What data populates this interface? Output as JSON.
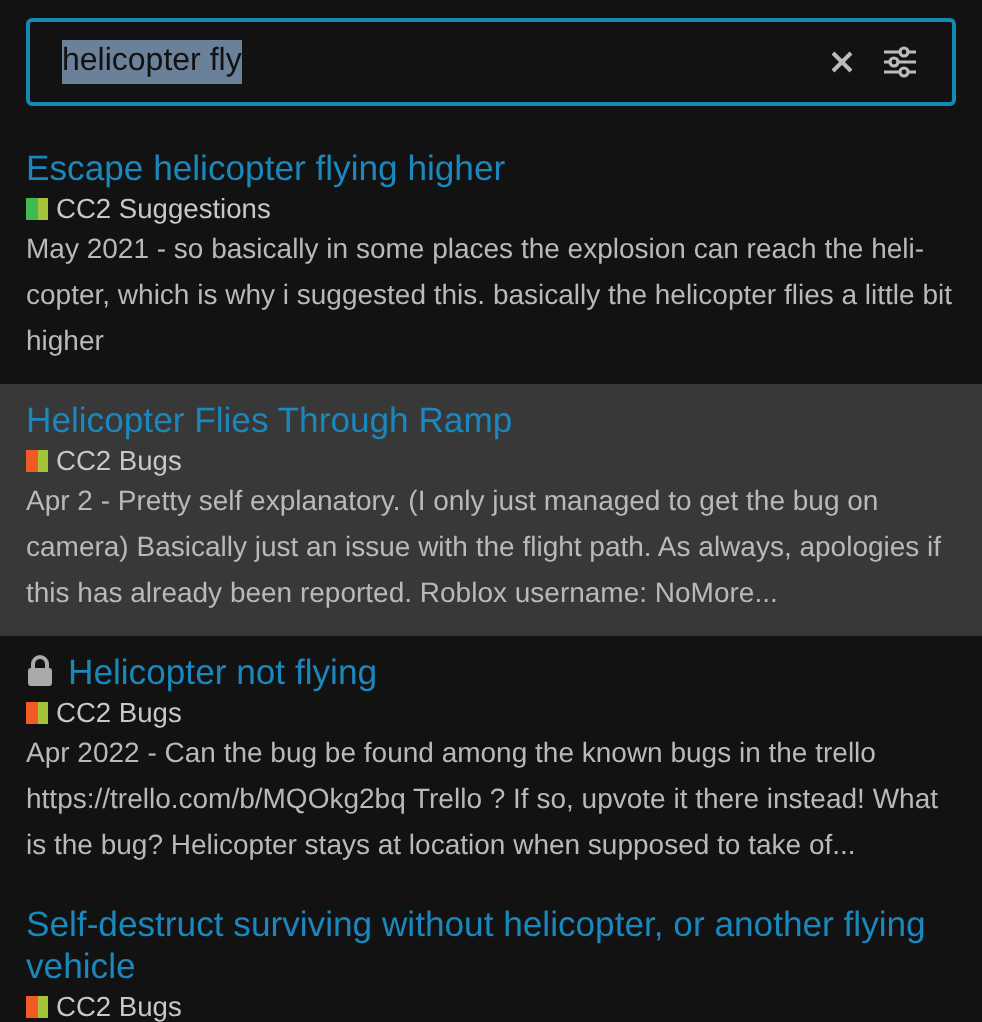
{
  "search": {
    "value": "helicopter fly",
    "value_selected": true
  },
  "results": [
    {
      "title": "Escape helicopter flying higher",
      "locked": false,
      "selected": false,
      "category": {
        "name": "CC2 Suggestions",
        "colors": [
          {
            "color": "#3fb950"
          },
          {
            "color": "#a4c339"
          }
        ]
      },
      "excerpt": "May 2021 - so basically in some places the explosion can reach the heli-copter, which is why i suggested this. basically the helicopter flies a little bit higher"
    },
    {
      "title": "Helicopter Flies Through Ramp",
      "locked": false,
      "selected": true,
      "category": {
        "name": "CC2 Bugs",
        "colors": [
          {
            "color": "#f15a24"
          },
          {
            "color": "#a4c339"
          }
        ]
      },
      "excerpt": "Apr 2 - Pretty self explanatory. (I only just managed to get the bug on camera) Basically just an issue with the flight path. As always, apologies if this has already been reported. Roblox username: NoMore..."
    },
    {
      "title": "Helicopter not flying",
      "locked": true,
      "selected": false,
      "category": {
        "name": "CC2 Bugs",
        "colors": [
          {
            "color": "#f15a24"
          },
          {
            "color": "#a4c339"
          }
        ]
      },
      "excerpt": "Apr 2022 - Can the bug be found among the known bugs in the trello https://trello.com/b/MQOkg2bq Trello ? If so, upvote it there instead! What is the bug? Helicopter stays at location when supposed to take of..."
    },
    {
      "title": "Self-destruct surviving without helicopter, or another flying vehicle",
      "locked": false,
      "selected": false,
      "category": {
        "name": "CC2 Bugs",
        "colors": [
          {
            "color": "#f15a24"
          },
          {
            "color": "#a4c339"
          }
        ]
      }
    }
  ]
}
